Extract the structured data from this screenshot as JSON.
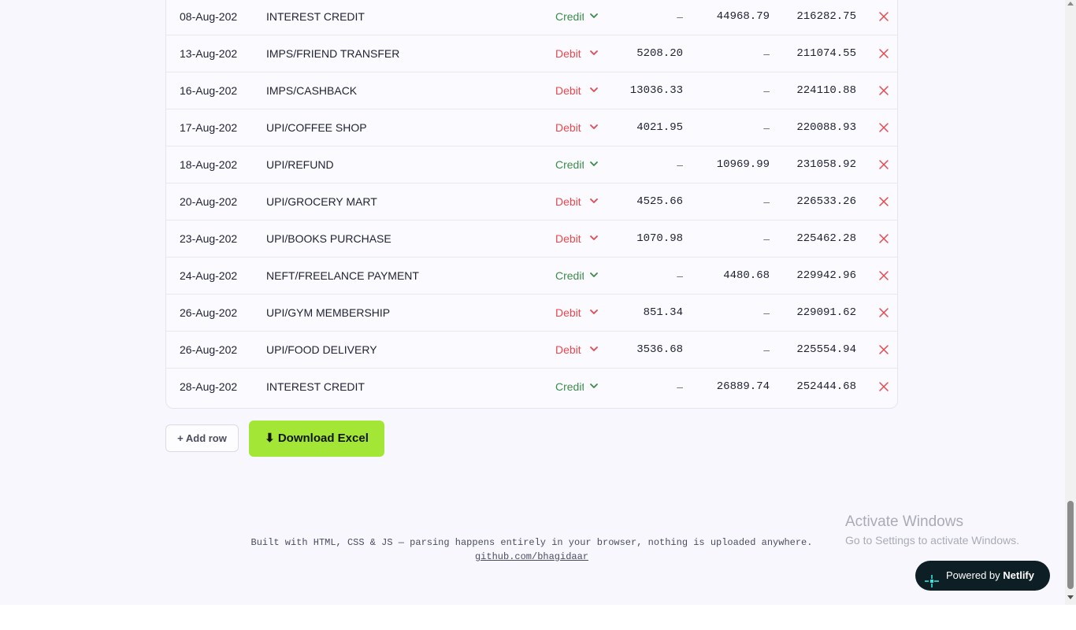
{
  "transactions": [
    {
      "date": "08-Aug-202",
      "description": "INTEREST CREDIT",
      "type": "Credit",
      "debit": "–",
      "credit": "44968.79",
      "balance": "216282.75"
    },
    {
      "date": "13-Aug-202",
      "description": "IMPS/FRIEND TRANSFER",
      "type": "Debit",
      "debit": "5208.20",
      "credit": "–",
      "balance": "211074.55"
    },
    {
      "date": "16-Aug-202",
      "description": "IMPS/CASHBACK",
      "type": "Debit",
      "debit": "13036.33",
      "credit": "–",
      "balance": "224110.88"
    },
    {
      "date": "17-Aug-202",
      "description": "UPI/COFFEE SHOP",
      "type": "Debit",
      "debit": "4021.95",
      "credit": "–",
      "balance": "220088.93"
    },
    {
      "date": "18-Aug-202",
      "description": "UPI/REFUND",
      "type": "Credit",
      "debit": "–",
      "credit": "10969.99",
      "balance": "231058.92"
    },
    {
      "date": "20-Aug-202",
      "description": "UPI/GROCERY MART",
      "type": "Debit",
      "debit": "4525.66",
      "credit": "–",
      "balance": "226533.26"
    },
    {
      "date": "23-Aug-202",
      "description": "UPI/BOOKS PURCHASE",
      "type": "Debit",
      "debit": "1070.98",
      "credit": "–",
      "balance": "225462.28"
    },
    {
      "date": "24-Aug-202",
      "description": "NEFT/FREELANCE PAYMENT",
      "type": "Credit",
      "debit": "–",
      "credit": "4480.68",
      "balance": "229942.96"
    },
    {
      "date": "26-Aug-202",
      "description": "UPI/GYM MEMBERSHIP",
      "type": "Debit",
      "debit": "851.34",
      "credit": "–",
      "balance": "229091.62"
    },
    {
      "date": "26-Aug-202",
      "description": "UPI/FOOD DELIVERY",
      "type": "Debit",
      "debit": "3536.68",
      "credit": "–",
      "balance": "225554.94"
    },
    {
      "date": "28-Aug-202",
      "description": "INTEREST CREDIT",
      "type": "Credit",
      "debit": "–",
      "credit": "26889.74",
      "balance": "252444.68"
    }
  ],
  "colors": {
    "credit": "#3b8c4a",
    "debit": "#e5484d",
    "delete": "#e5484d",
    "download_button": "#a3e635",
    "netlify_badge": "#0e1e25"
  },
  "icons": {
    "type_dropdown": "chevron-down-icon",
    "delete_row": "close-icon",
    "netlify": "netlify-logo-icon"
  },
  "actions": {
    "add_row_label": "+ Add row",
    "download_label": "⬇ Download Excel"
  },
  "footer": {
    "text": "Built with HTML, CSS & JS — parsing happens entirely in your browser, nothing is uploaded anywhere.",
    "link": "github.com/bhagidaar"
  },
  "windows_watermark": {
    "title": "Activate Windows",
    "subtitle": "Go to Settings to activate Windows."
  },
  "netlify_badge": {
    "prefix": "Powered by ",
    "brand": "Netlify"
  }
}
